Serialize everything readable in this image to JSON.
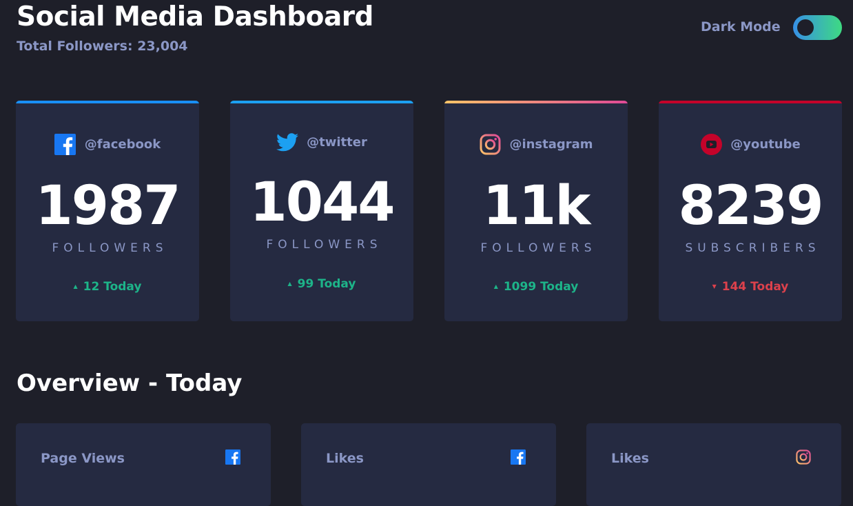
{
  "header": {
    "title": "Social Media Dashboard",
    "total_followers": "Total Followers: 23,004",
    "dark_mode_label": "Dark Mode",
    "dark_mode_enabled": true
  },
  "cards": [
    {
      "platform": "facebook",
      "icon": "facebook-icon",
      "handle": "@facebook",
      "count": "1987",
      "unit": "FOLLOWERS",
      "change": "12 Today",
      "trend": "up",
      "accent": "#198ff5"
    },
    {
      "platform": "twitter",
      "icon": "twitter-icon",
      "handle": "@twitter",
      "count": "1044",
      "unit": "FOLLOWERS",
      "change": "99 Today",
      "trend": "up",
      "accent": "#1ca0f2"
    },
    {
      "platform": "instagram",
      "icon": "instagram-icon",
      "handle": "@instagram",
      "count": "11k",
      "unit": "FOLLOWERS",
      "change": "1099 Today",
      "trend": "up",
      "accent": "#df4996"
    },
    {
      "platform": "youtube",
      "icon": "youtube-icon",
      "handle": "@youtube",
      "count": "8239",
      "unit": "SUBSCRIBERS",
      "change": "144 Today",
      "trend": "down",
      "accent": "#c4032a"
    }
  ],
  "overview": {
    "title": "Overview - Today",
    "items": [
      {
        "label": "Page Views",
        "icon": "facebook-icon"
      },
      {
        "label": "Likes",
        "icon": "facebook-icon"
      },
      {
        "label": "Likes",
        "icon": "instagram-icon"
      }
    ]
  },
  "colors": {
    "background": "#1e1f29",
    "card": "#252a41",
    "text_muted": "#8b97c6",
    "up": "#1db489",
    "down": "#dc414c",
    "toggle_start": "#378fe6",
    "toggle_end": "#3eda82",
    "instagram_start": "#fdc468",
    "instagram_end": "#df4996"
  }
}
